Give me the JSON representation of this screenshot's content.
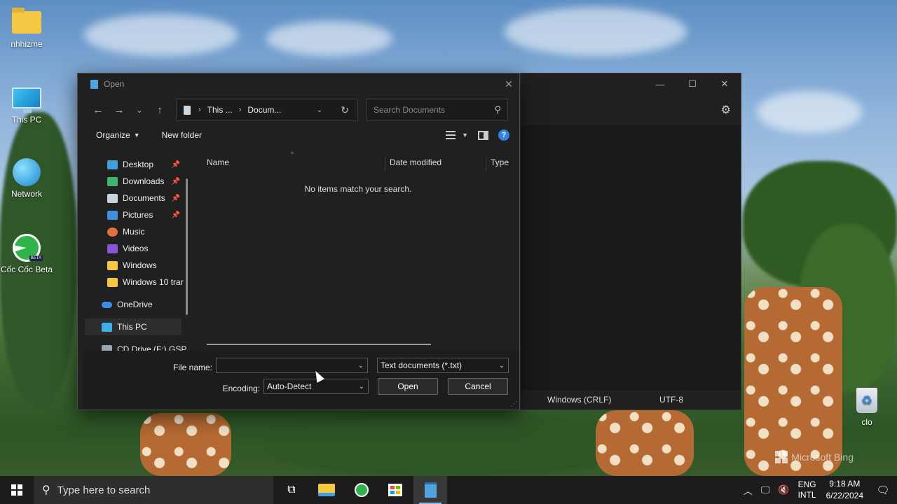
{
  "desktop": {
    "icons": [
      {
        "label": "nhhizme",
        "icon": "folder-icon"
      },
      {
        "label": "This PC",
        "icon": "this-pc-icon"
      },
      {
        "label": "Network",
        "icon": "network-icon"
      },
      {
        "label": "Cốc Cốc Beta",
        "icon": "coccoc-beta-icon"
      },
      {
        "label": "clo",
        "icon": "recycle-bin-icon"
      }
    ],
    "beta_tag": "BETA",
    "watermark": "Microsoft Bing"
  },
  "notepad": {
    "status_line_ending": "Windows (CRLF)",
    "status_encoding": "UTF-8",
    "settings_icon": "gear-icon"
  },
  "dialog": {
    "title": "Open",
    "address": {
      "segments": [
        "This ...",
        "Docum..."
      ]
    },
    "search_placeholder": "Search Documents",
    "commands": {
      "organize": "Organize",
      "new_folder": "New folder"
    },
    "help": "?",
    "nav_items": [
      {
        "label": "Desktop",
        "color": "#3fa0e0",
        "pinned": true
      },
      {
        "label": "Downloads",
        "color": "#3fb56a",
        "pinned": true
      },
      {
        "label": "Documents",
        "color": "#c9d3dc",
        "pinned": true
      },
      {
        "label": "Pictures",
        "color": "#3f8fe0",
        "pinned": true
      },
      {
        "label": "Music",
        "color": "#e07040",
        "pinned": false
      },
      {
        "label": "Videos",
        "color": "#8a56d8",
        "pinned": false
      },
      {
        "label": "Windows",
        "color": "#f5c842",
        "pinned": false
      },
      {
        "label": "Windows 10 trar",
        "color": "#f5c842",
        "pinned": false
      },
      {
        "label": "OneDrive",
        "color": "#3a8ee6",
        "pinned": false
      },
      {
        "label": "This PC",
        "color": "#3cb0e8",
        "pinned": false
      },
      {
        "label": "CD Drive (F:) GSP",
        "color": "#9aa6b0",
        "pinned": false
      }
    ],
    "columns": {
      "name": "Name",
      "date_modified": "Date modified",
      "type": "Type"
    },
    "empty_message": "No items match your search.",
    "file_name_label": "File name:",
    "file_name_value": "",
    "file_type_value": "Text documents (*.txt)",
    "encoding_label": "Encoding:",
    "encoding_value": "Auto-Detect",
    "open_button": "Open",
    "cancel_button": "Cancel"
  },
  "taskbar": {
    "search_placeholder": "Type here to search",
    "lang_top": "ENG",
    "lang_bottom": "INTL",
    "time": "9:18 AM",
    "date": "6/22/2024"
  }
}
